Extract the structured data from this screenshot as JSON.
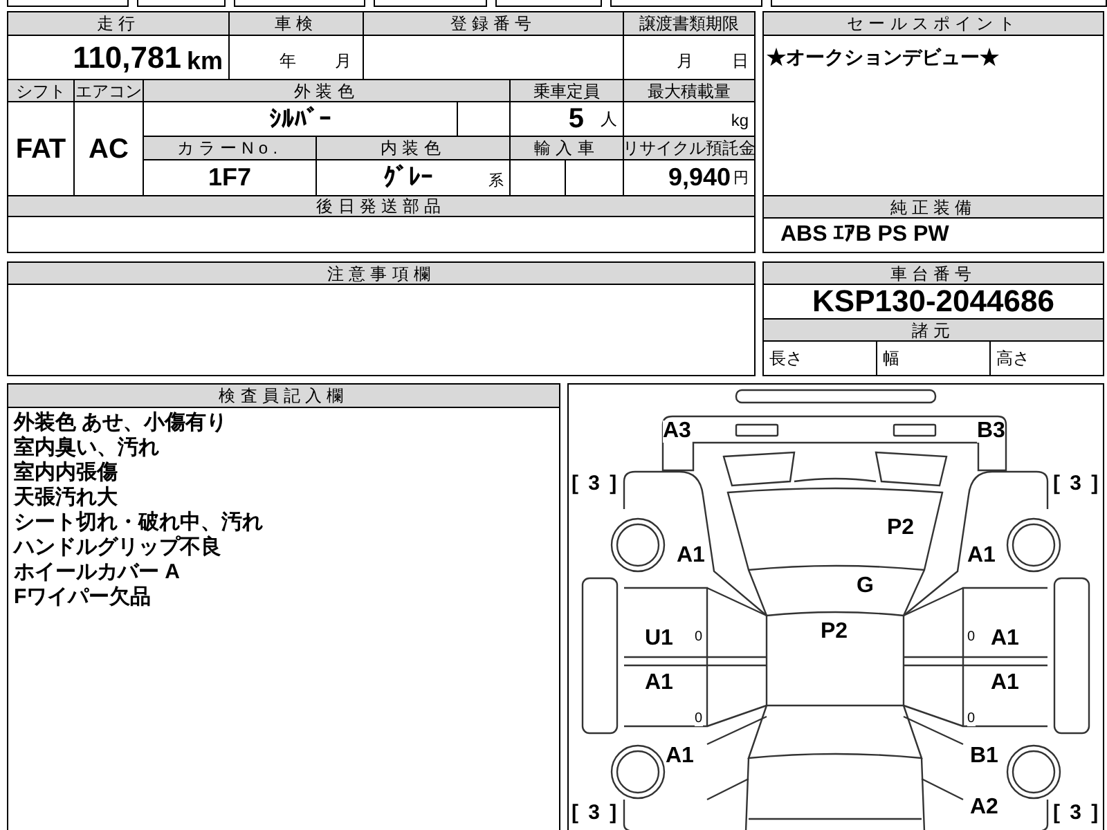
{
  "vehicle": {
    "mileage_header": "走行",
    "mileage": "110,781",
    "mileage_unit": "km",
    "inspection_header": "車検",
    "inspection_year_unit": "年",
    "inspection_month_unit": "月",
    "registration_header": "登録番号",
    "transfer_deadline_header": "譲渡書類期限",
    "transfer_month_unit": "月",
    "transfer_day_unit": "日",
    "shift_header": "シフト",
    "shift": "FAT",
    "ac_header": "エアコン",
    "ac": "AC",
    "exterior_color_header": "外装色",
    "exterior_color": "ｼﾙﾊﾞｰ",
    "capacity_header": "乗車定員",
    "capacity": "5",
    "capacity_unit": "人",
    "max_load_header": "最大積載量",
    "max_load_unit": "kg",
    "color_no_header": "カラーNo.",
    "color_no": "1F7",
    "interior_color_header": "内装色",
    "interior_color": "ｸﾞﾚｰ",
    "interior_color_suffix": "系",
    "import_header": "輸入車",
    "recycle_header": "リサイクル預託金",
    "recycle_fee": "9,940",
    "recycle_unit": "円",
    "later_parts_header": "後日発送部品"
  },
  "sales_point": {
    "header": "セールスポイント",
    "text": "★オークションデビュー★"
  },
  "equipment": {
    "header": "純正装備",
    "text": "ABS ｴｱB PS PW"
  },
  "notes": {
    "header": "注意事項欄"
  },
  "chassis": {
    "header": "車台番号",
    "number": "KSP130-2044686",
    "specs_header": "諸元",
    "specs": [
      "長さ",
      "幅",
      "高さ"
    ]
  },
  "inspector": {
    "header": "検査員記入欄",
    "lines": [
      "外装色 あせ、小傷有り",
      "室内臭い、汚れ",
      "室内内張傷",
      "天張汚れ大",
      "シート切れ・破れ中、汚れ",
      "ハンドルグリップ不良",
      "ホイールカバー A",
      "Fワイパー欠品"
    ]
  },
  "diagram_marks": [
    {
      "kind": "code",
      "text": "A3"
    },
    {
      "kind": "code",
      "text": "B3"
    },
    {
      "kind": "bracket",
      "text": "[ 3 ]"
    },
    {
      "kind": "bracket",
      "text": "[ 3 ]"
    },
    {
      "kind": "code",
      "text": "P2"
    },
    {
      "kind": "code",
      "text": "A1"
    },
    {
      "kind": "code",
      "text": "A1"
    },
    {
      "kind": "code",
      "text": "G"
    },
    {
      "kind": "code",
      "text": "P2"
    },
    {
      "kind": "code",
      "text": "U1"
    },
    {
      "kind": "small",
      "text": "0"
    },
    {
      "kind": "small",
      "text": "0"
    },
    {
      "kind": "code",
      "text": "A1"
    },
    {
      "kind": "code",
      "text": "A1"
    },
    {
      "kind": "code",
      "text": "A1"
    },
    {
      "kind": "small",
      "text": "0"
    },
    {
      "kind": "small",
      "text": "0"
    },
    {
      "kind": "code",
      "text": "A1"
    },
    {
      "kind": "code",
      "text": "B1"
    },
    {
      "kind": "bracket",
      "text": "[ 3 ]"
    },
    {
      "kind": "code",
      "text": "A2"
    },
    {
      "kind": "bracket",
      "text": "[ 3 ]"
    }
  ]
}
